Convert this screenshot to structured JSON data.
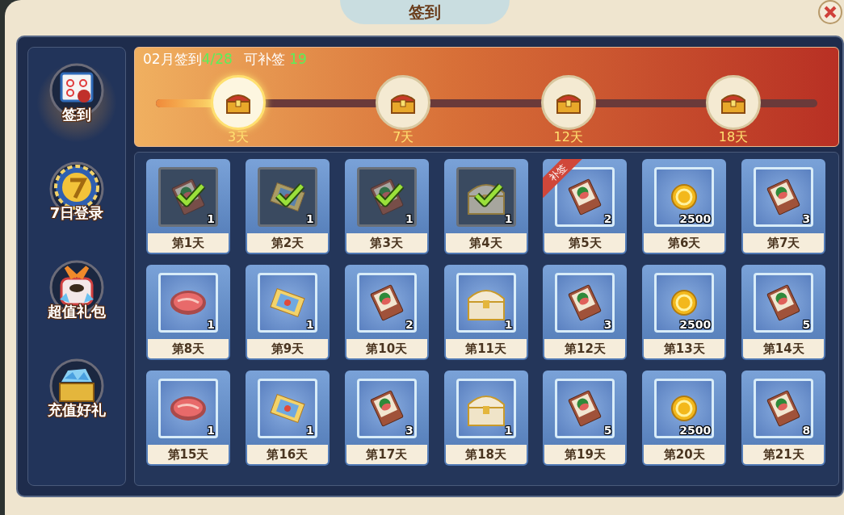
{
  "window": {
    "title": "签到"
  },
  "sidebar": {
    "items": [
      {
        "label": "签到",
        "kind": "calendar",
        "selected": true
      },
      {
        "label": "7日登录",
        "kind": "seven",
        "selected": false
      },
      {
        "label": "超值礼包",
        "kind": "gift",
        "selected": false
      },
      {
        "label": "充值好礼",
        "kind": "chest",
        "selected": false
      }
    ]
  },
  "header": {
    "month_label": "02月签到",
    "signed": "4/28",
    "makeup_label": "可补签",
    "makeup_count": "19",
    "progress": {
      "level": 0.1
    },
    "milestones": [
      {
        "label": "3天",
        "reached": true
      },
      {
        "label": "7天",
        "reached": false
      },
      {
        "label": "12天",
        "reached": false
      },
      {
        "label": "18天",
        "reached": false
      }
    ]
  },
  "days": [
    {
      "label": "第1天",
      "kind": "card",
      "count": "1",
      "claimed": true
    },
    {
      "label": "第2天",
      "kind": "ticket",
      "count": "1",
      "claimed": true
    },
    {
      "label": "第3天",
      "kind": "card",
      "count": "1",
      "claimed": true
    },
    {
      "label": "第4天",
      "kind": "goldchest",
      "count": "1",
      "claimed": true
    },
    {
      "label": "第5天",
      "kind": "card",
      "count": "2",
      "claimed": false,
      "ribbon": "补签"
    },
    {
      "label": "第6天",
      "kind": "coin",
      "count": "2500",
      "claimed": false
    },
    {
      "label": "第7天",
      "kind": "card",
      "count": "3",
      "claimed": false
    },
    {
      "label": "第8天",
      "kind": "meat",
      "count": "1",
      "claimed": false
    },
    {
      "label": "第9天",
      "kind": "ticket",
      "count": "1",
      "claimed": false
    },
    {
      "label": "第10天",
      "kind": "card",
      "count": "2",
      "claimed": false
    },
    {
      "label": "第11天",
      "kind": "goldchest",
      "count": "1",
      "claimed": false
    },
    {
      "label": "第12天",
      "kind": "card",
      "count": "3",
      "claimed": false
    },
    {
      "label": "第13天",
      "kind": "coin",
      "count": "2500",
      "claimed": false
    },
    {
      "label": "第14天",
      "kind": "card",
      "count": "5",
      "claimed": false
    },
    {
      "label": "第15天",
      "kind": "meat",
      "count": "1",
      "claimed": false
    },
    {
      "label": "第16天",
      "kind": "ticket",
      "count": "1",
      "claimed": false
    },
    {
      "label": "第17天",
      "kind": "card",
      "count": "3",
      "claimed": false
    },
    {
      "label": "第18天",
      "kind": "goldchest",
      "count": "1",
      "claimed": false
    },
    {
      "label": "第19天",
      "kind": "card",
      "count": "5",
      "claimed": false
    },
    {
      "label": "第20天",
      "kind": "coin",
      "count": "2500",
      "claimed": false
    },
    {
      "label": "第21天",
      "kind": "card",
      "count": "8",
      "claimed": false
    }
  ]
}
